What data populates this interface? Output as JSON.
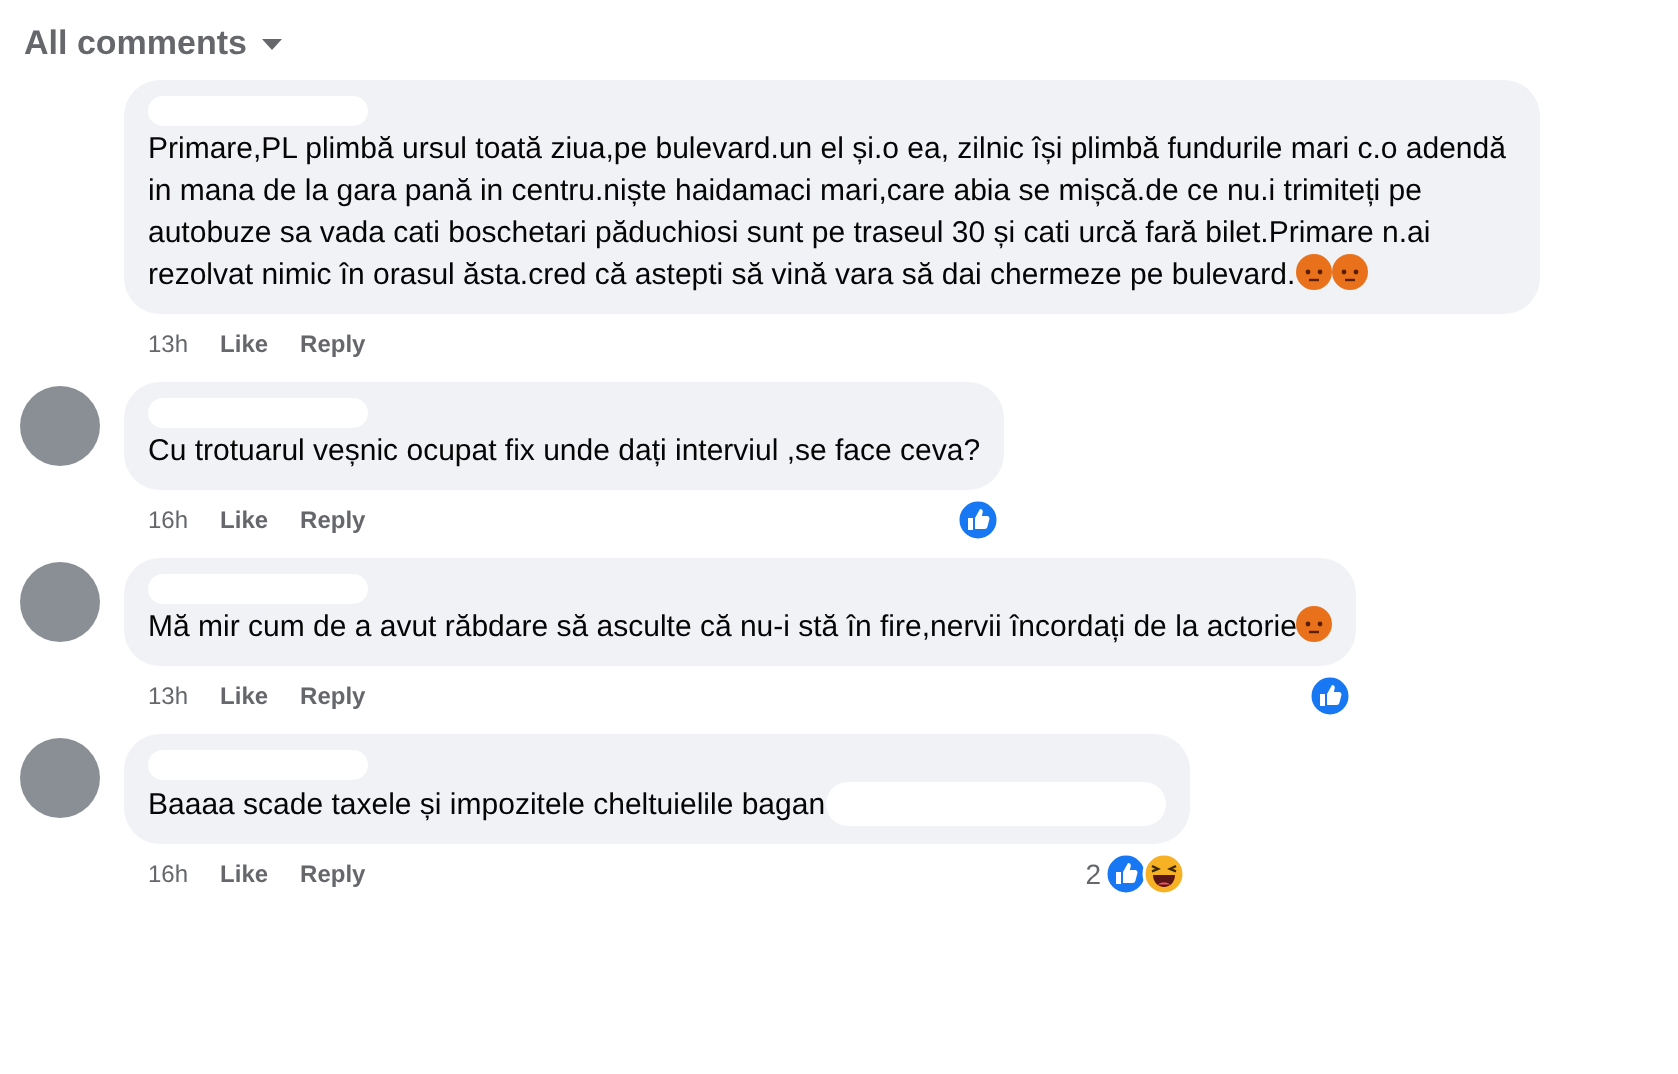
{
  "header": {
    "label": "All comments"
  },
  "comments": [
    {
      "has_avatar": false,
      "text": "Primare,PL plimbă ursul toată ziua,pe bulevard.un el și.o ea, zilnic își plimbă fundurile mari c.o adendă in mana de la gara pană in centru.niște haidamaci mari,care abia se mișcă.de ce nu.i trimiteți pe autobuze sa vada cati boschetari păduchiosi sunt pe traseul 30 și cati urcă fară bilet.Primare n.ai rezolvat nimic în orasul ăsta.cred că astepti să vină vara să dai chermeze pe bulevard.",
      "emoji": [
        {
          "kind": "angry"
        },
        {
          "kind": "angry"
        }
      ],
      "time": "13h",
      "like": "Like",
      "reply": "Reply"
    },
    {
      "has_avatar": true,
      "text": "Cu trotuarul veșnic ocupat fix unde dați interviul ,se face ceva?",
      "time": "16h",
      "like": "Like",
      "reply": "Reply",
      "reactions": {
        "types": [
          {
            "kind": "like"
          }
        ]
      }
    },
    {
      "has_avatar": true,
      "text": "Mă mir cum de a avut răbdare să asculte că nu-i stă în fire,nervii încordați de la actorie",
      "emoji": [
        {
          "kind": "angry"
        }
      ],
      "time": "13h",
      "like": "Like",
      "reply": "Reply",
      "reactions": {
        "types": [
          {
            "kind": "like"
          }
        ]
      }
    },
    {
      "has_avatar": true,
      "text": "Baaaa scade taxele și impozitele cheltuielile bagan",
      "redacted_tail": true,
      "time": "16h",
      "like": "Like",
      "reply": "Reply",
      "reactions": {
        "count": "2",
        "types": [
          {
            "kind": "like"
          },
          {
            "kind": "haha"
          }
        ]
      }
    }
  ]
}
